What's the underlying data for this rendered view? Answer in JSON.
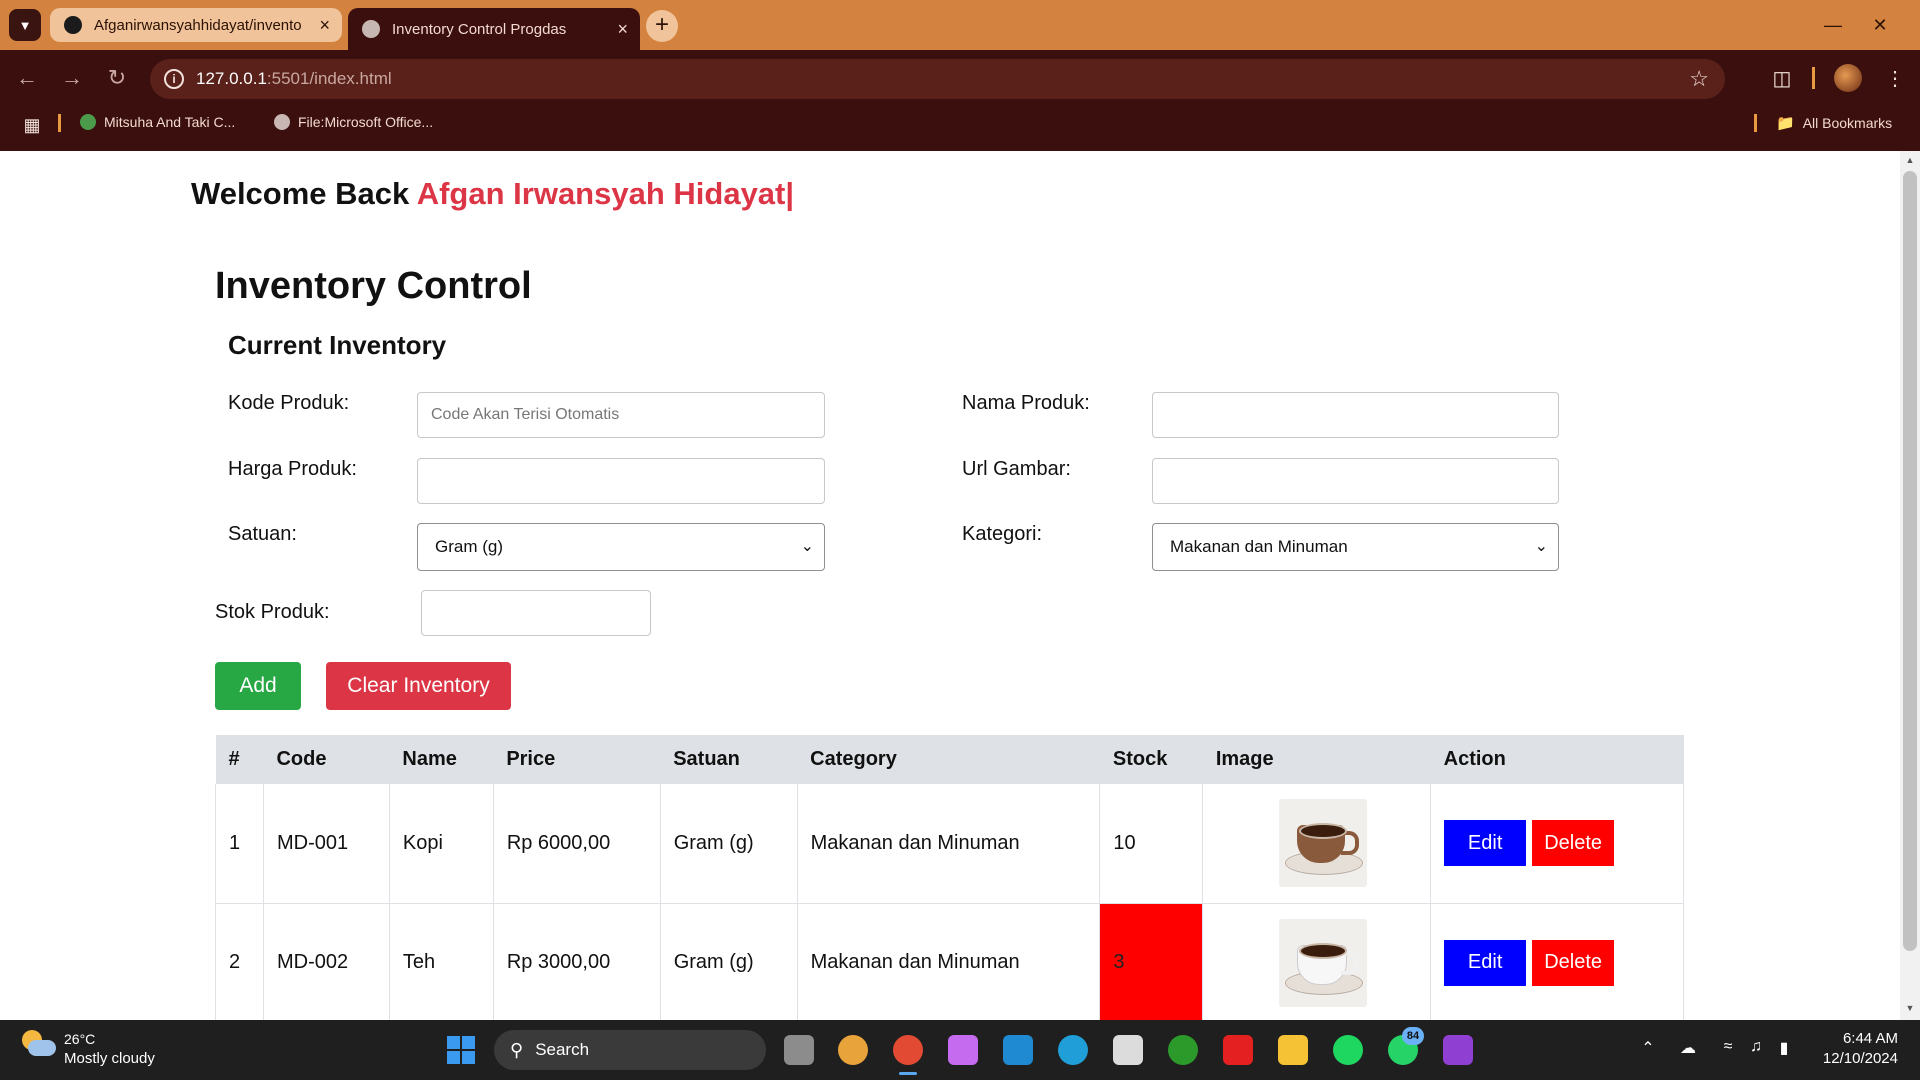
{
  "browser": {
    "tabs": [
      {
        "title": "Afganirwansyahhidayat/invento",
        "active": false
      },
      {
        "title": "Inventory Control Progdas",
        "active": true
      }
    ],
    "url_host": "127.0.0.1",
    "url_rest": ":5501/index.html",
    "bookmarks": [
      {
        "label": "Mitsuha And Taki C..."
      },
      {
        "label": "File:Microsoft Office..."
      }
    ],
    "all_bookmarks_label": "All Bookmarks"
  },
  "page": {
    "welcome_prefix": "Welcome Back ",
    "welcome_name": "Afgan Irwansyah Hidayat|",
    "title": "Inventory Control",
    "section_title": "Current Inventory",
    "form": {
      "kode_label": "Kode Produk:",
      "kode_placeholder": "Code Akan Terisi Otomatis",
      "nama_label": "Nama Produk:",
      "harga_label": "Harga Produk:",
      "url_label": "Url Gambar:",
      "satuan_label": "Satuan:",
      "satuan_value": "Gram (g)",
      "kategori_label": "Kategori:",
      "kategori_value": "Makanan dan Minuman",
      "stok_label": "Stok Produk:"
    },
    "buttons": {
      "add": "Add",
      "clear": "Clear Inventory"
    },
    "table": {
      "headers": [
        "#",
        "Code",
        "Name",
        "Price",
        "Satuan",
        "Category",
        "Stock",
        "Image",
        "Action"
      ],
      "rows": [
        {
          "no": "1",
          "code": "MD-001",
          "name": "Kopi",
          "price": "Rp 6000,00",
          "satuan": "Gram (g)",
          "category": "Makanan dan Minuman",
          "stock": "10",
          "low_stock": false,
          "image": "coffee-cup-image",
          "edit": "Edit",
          "delete": "Delete"
        },
        {
          "no": "2",
          "code": "MD-002",
          "name": "Teh",
          "price": "Rp 3000,00",
          "satuan": "Gram (g)",
          "category": "Makanan dan Minuman",
          "stock": "3",
          "low_stock": true,
          "image": "tea-cup-image",
          "edit": "Edit",
          "delete": "Delete"
        }
      ]
    }
  },
  "taskbar": {
    "weather_temp": "26°C",
    "weather_desc": "Mostly cloudy",
    "search_label": "Search",
    "whatsapp_badge": "84",
    "time": "6:44 AM",
    "date": "12/10/2024"
  },
  "colors": {
    "chrome_tabstrip": "#d3823f",
    "chrome_toolbar": "#3a0f0d",
    "welcome_name": "#dc3545",
    "add_button": "#28a745",
    "clear_button": "#dc3545",
    "edit_button": "#0000ff",
    "delete_button": "#ff0000",
    "low_stock": "#ff0000"
  }
}
